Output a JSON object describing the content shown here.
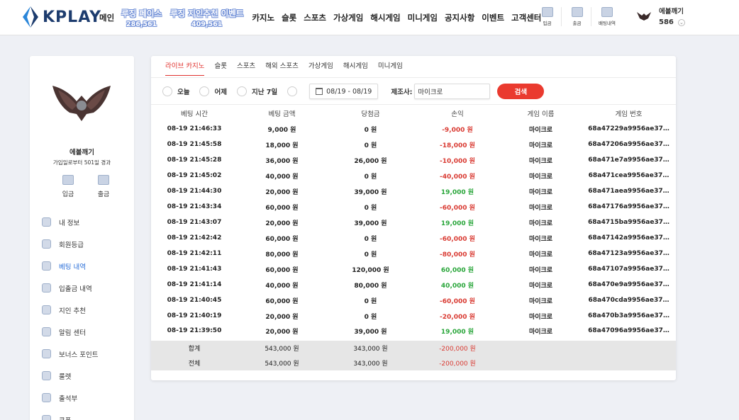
{
  "header": {
    "logo_text": "KPLAY",
    "nav": [
      {
        "label": "메인",
        "highlight": false
      },
      {
        "label": "루징 페이스",
        "sub": "286,561",
        "highlight": true
      },
      {
        "label": "루징 지인추천 이벤트",
        "sub": "409,561",
        "highlight": true
      },
      {
        "label": "카지노",
        "highlight": false
      },
      {
        "label": "슬롯",
        "highlight": false
      },
      {
        "label": "스포츠",
        "highlight": false
      },
      {
        "label": "가상게임",
        "highlight": false
      },
      {
        "label": "해시게임",
        "highlight": false
      },
      {
        "label": "미니게임",
        "highlight": false
      },
      {
        "label": "공지사항",
        "highlight": false
      },
      {
        "label": "이벤트",
        "highlight": false
      },
      {
        "label": "고객센터",
        "highlight": false
      }
    ],
    "icons": [
      {
        "label": "입금",
        "icon": "deposit-icon"
      },
      {
        "label": "출금",
        "icon": "withdraw-icon"
      },
      {
        "label": "배팅내역",
        "icon": "bet-history-icon"
      }
    ],
    "user": {
      "name": "에볼깨기",
      "points": "586"
    }
  },
  "sidebar": {
    "name": "에볼깨기",
    "since": "가입일로부터 501일 경과",
    "actions": [
      {
        "label": "입금"
      },
      {
        "label": "출금"
      }
    ],
    "menu": [
      {
        "label": "내 정보",
        "active": false
      },
      {
        "label": "회원등급",
        "active": false
      },
      {
        "label": "베팅 내역",
        "active": true
      },
      {
        "label": "입출금 내역",
        "active": false
      },
      {
        "label": "지인 추천",
        "active": false
      },
      {
        "label": "알림 센터",
        "active": false
      },
      {
        "label": "보너스 포인트",
        "active": false
      },
      {
        "label": "룰렛",
        "active": false
      },
      {
        "label": "출석부",
        "active": false
      },
      {
        "label": "쿠폰",
        "active": false
      }
    ]
  },
  "tabs": [
    {
      "label": "라이브 카지노",
      "active": true
    },
    {
      "label": "슬롯",
      "active": false
    },
    {
      "label": "스포츠",
      "active": false
    },
    {
      "label": "해외 스포츠",
      "active": false
    },
    {
      "label": "가상게임",
      "active": false
    },
    {
      "label": "해시게임",
      "active": false
    },
    {
      "label": "미니게임",
      "active": false
    }
  ],
  "filters": {
    "radios": [
      "오늘",
      "어제",
      "지난 7일"
    ],
    "date_range": "08/19 - 08/19",
    "maker_label": "제조사:",
    "maker_value": "마이크로",
    "search_label": "검색"
  },
  "table": {
    "columns": [
      "베팅 시간",
      "베팅 금액",
      "당첨금",
      "손익",
      "게임 이름",
      "게임 번호"
    ],
    "rows": [
      [
        "08-19 21:46:33",
        "9,000 원",
        "0 원",
        "-9,000 원",
        "마이크로",
        "68a47229a9956ae37…"
      ],
      [
        "08-19 21:45:58",
        "18,000 원",
        "0 원",
        "-18,000 원",
        "마이크로",
        "68a47206a9956ae37…"
      ],
      [
        "08-19 21:45:28",
        "36,000 원",
        "26,000 원",
        "-10,000 원",
        "마이크로",
        "68a471e7a9956ae37…"
      ],
      [
        "08-19 21:45:02",
        "40,000 원",
        "0 원",
        "-40,000 원",
        "마이크로",
        "68a471cea9956ae37…"
      ],
      [
        "08-19 21:44:30",
        "20,000 원",
        "39,000 원",
        "19,000 원",
        "마이크로",
        "68a471aea9956ae37…"
      ],
      [
        "08-19 21:43:34",
        "60,000 원",
        "0 원",
        "-60,000 원",
        "마이크로",
        "68a47176a9956ae37…"
      ],
      [
        "08-19 21:43:07",
        "20,000 원",
        "39,000 원",
        "19,000 원",
        "마이크로",
        "68a4715ba9956ae37…"
      ],
      [
        "08-19 21:42:42",
        "60,000 원",
        "0 원",
        "-60,000 원",
        "마이크로",
        "68a47142a9956ae37…"
      ],
      [
        "08-19 21:42:11",
        "80,000 원",
        "0 원",
        "-80,000 원",
        "마이크로",
        "68a47123a9956ae37…"
      ],
      [
        "08-19 21:41:43",
        "60,000 원",
        "120,000 원",
        "60,000 원",
        "마이크로",
        "68a47107a9956ae37…"
      ],
      [
        "08-19 21:41:14",
        "40,000 원",
        "80,000 원",
        "40,000 원",
        "마이크로",
        "68a470e9a9956ae37…"
      ],
      [
        "08-19 21:40:45",
        "60,000 원",
        "0 원",
        "-60,000 원",
        "마이크로",
        "68a470cda9956ae37…"
      ],
      [
        "08-19 21:40:19",
        "20,000 원",
        "0 원",
        "-20,000 원",
        "마이크로",
        "68a470b3a9956ae37…"
      ],
      [
        "08-19 21:39:50",
        "20,000 원",
        "39,000 원",
        "19,000 원",
        "마이크로",
        "68a47096a9956ae37…"
      ]
    ],
    "summary": [
      {
        "label": "합계",
        "bet": "543,000 원",
        "win": "343,000 원",
        "pl": "-200,000 원"
      },
      {
        "label": "전체",
        "bet": "543,000 원",
        "win": "343,000 원",
        "pl": "-200,000 원"
      }
    ]
  },
  "colors": {
    "accent": "#e0322e",
    "negative": "#d93a32",
    "positive": "#2aa63b",
    "active_link": "#2a6ed8"
  }
}
